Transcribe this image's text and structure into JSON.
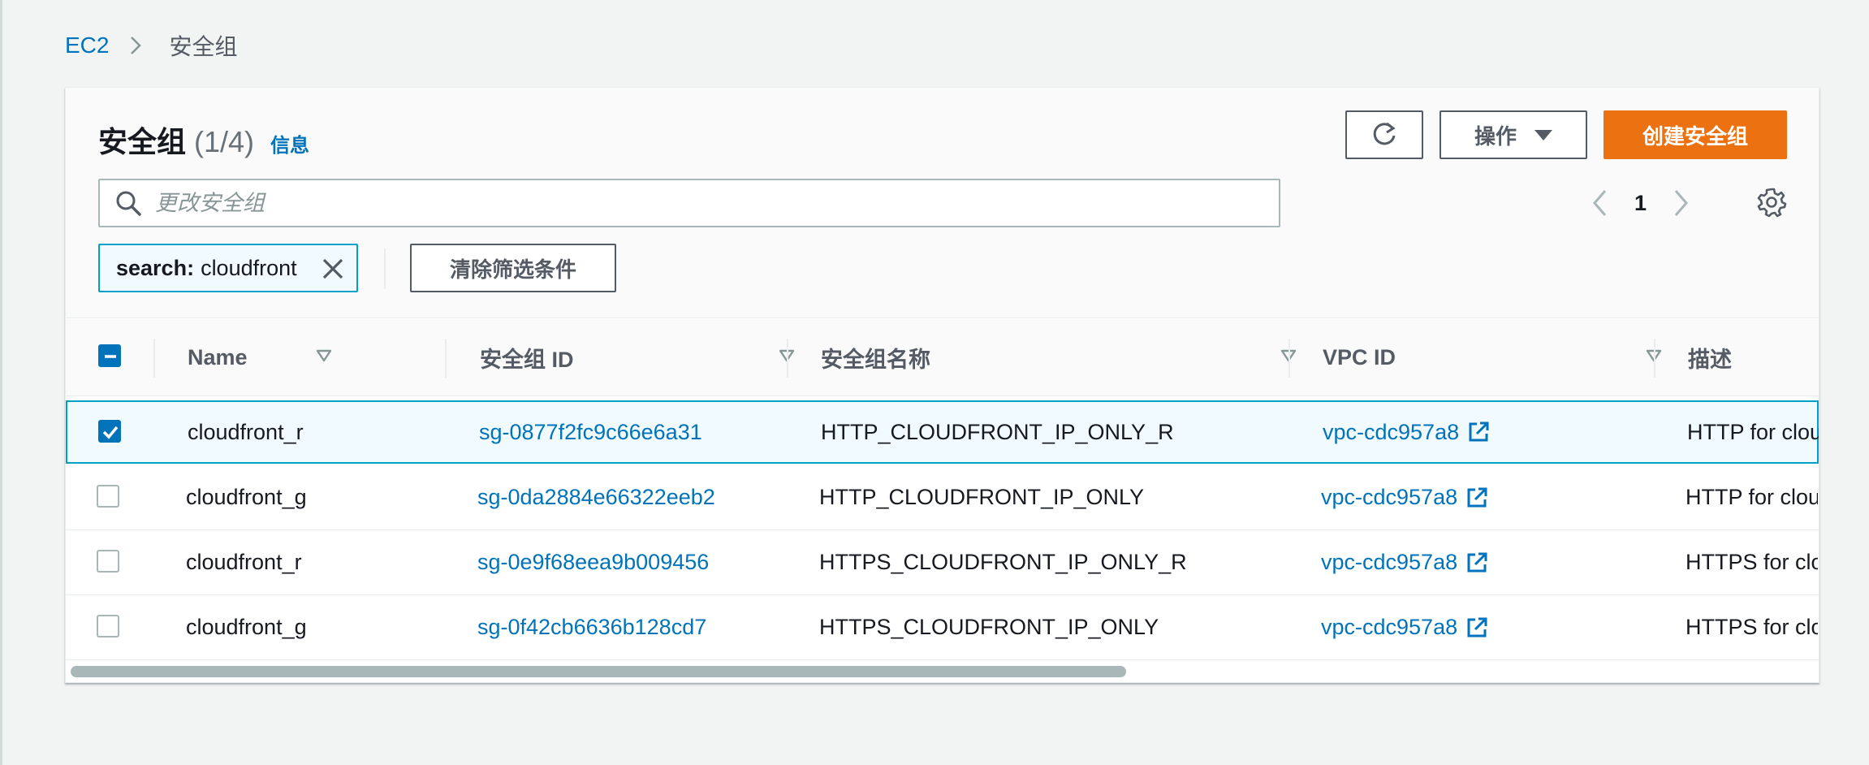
{
  "breadcrumb": {
    "root": "EC2",
    "current": "安全组"
  },
  "header": {
    "title": "安全组",
    "count": "(1/4)",
    "info": "信息"
  },
  "toolbar": {
    "actions_label": "操作",
    "create_label": "创建安全组"
  },
  "search": {
    "placeholder": "更改安全组"
  },
  "pagination": {
    "current_page": "1"
  },
  "filter": {
    "token_key": "search:",
    "token_value": "cloudfront",
    "clear_label": "清除筛选条件"
  },
  "table": {
    "columns": {
      "name": "Name",
      "sg_id": "安全组 ID",
      "sg_name": "安全组名称",
      "vpc_id": "VPC ID",
      "desc": "描述"
    },
    "rows": [
      {
        "selected": true,
        "name": "cloudfront_r",
        "sg_id": "sg-0877f2fc9c66e6a31",
        "sg_name": "HTTP_CLOUDFRONT_IP_ONLY_R",
        "vpc_id": "vpc-cdc957a8",
        "desc": "HTTP for clou"
      },
      {
        "selected": false,
        "name": "cloudfront_g",
        "sg_id": "sg-0da2884e66322eeb2",
        "sg_name": "HTTP_CLOUDFRONT_IP_ONLY",
        "vpc_id": "vpc-cdc957a8",
        "desc": "HTTP for clou"
      },
      {
        "selected": false,
        "name": "cloudfront_r",
        "sg_id": "sg-0e9f68eea9b009456",
        "sg_name": "HTTPS_CLOUDFRONT_IP_ONLY_R",
        "vpc_id": "vpc-cdc957a8",
        "desc": "HTTPS for clo"
      },
      {
        "selected": false,
        "name": "cloudfront_g",
        "sg_id": "sg-0f42cb6636b128cd7",
        "sg_name": "HTTPS_CLOUDFRONT_IP_ONLY",
        "vpc_id": "vpc-cdc957a8",
        "desc": "HTTPS for clo"
      }
    ]
  },
  "colors": {
    "link": "#0073bb",
    "primary": "#ec7211",
    "selected_border": "#00a1c9",
    "text": "#16191f",
    "muted": "#545b64"
  }
}
